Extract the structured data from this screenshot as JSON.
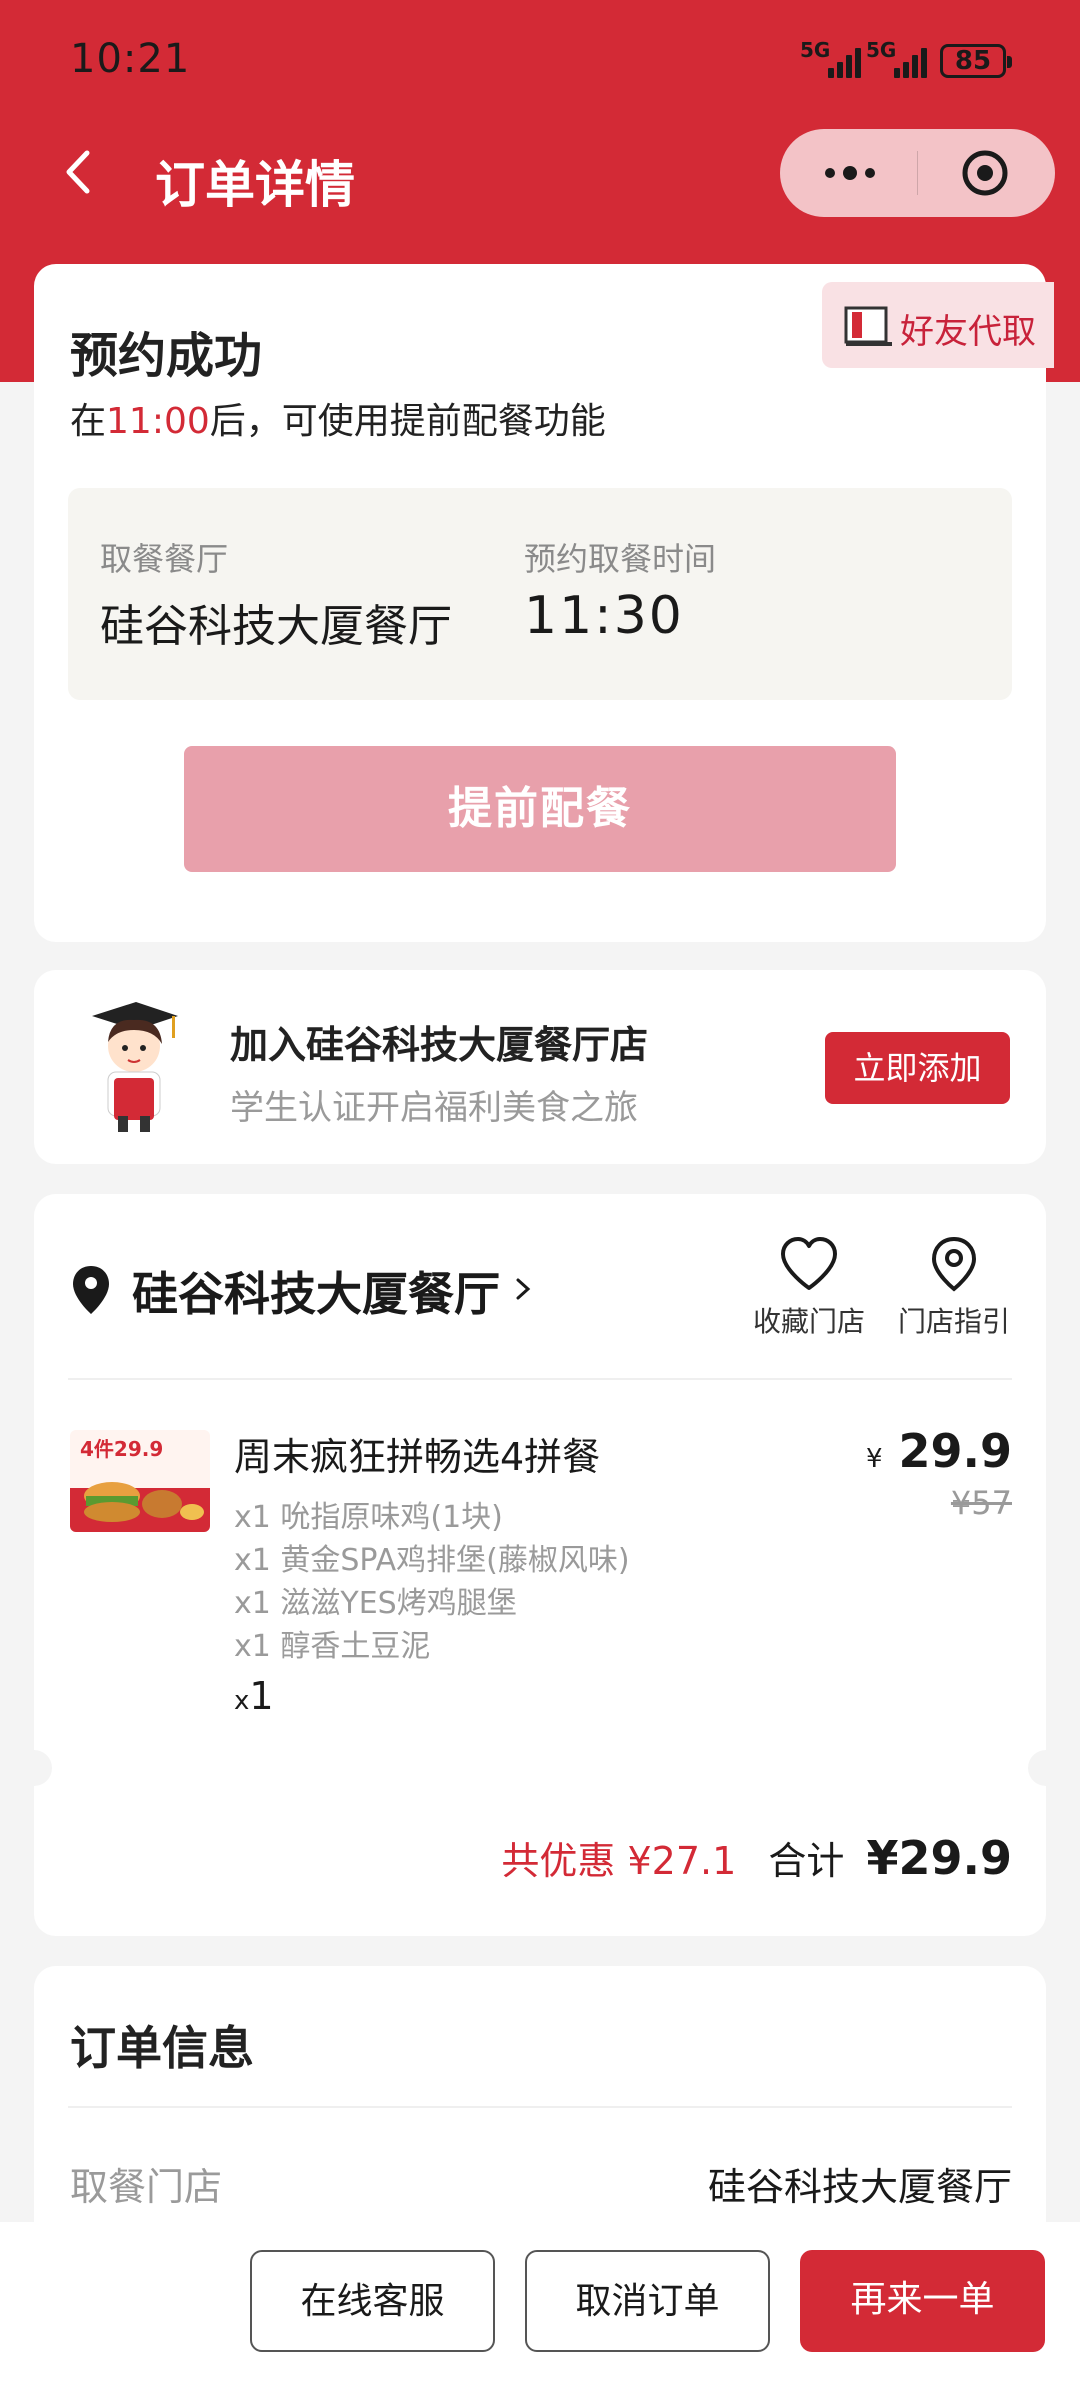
{
  "status_bar": {
    "time": "10:21",
    "signal1": "5G",
    "signal2": "5G",
    "battery": "85"
  },
  "nav": {
    "title": "订单详情"
  },
  "reservation": {
    "friend_pickup": "好友代取",
    "heading": "预约成功",
    "subtitle_pre": "在",
    "subtitle_time": "11:00",
    "subtitle_post": "后，可使用提前配餐功能",
    "restaurant_label": "取餐餐厅",
    "restaurant_value": "硅谷科技大厦餐厅",
    "time_label": "预约取餐时间",
    "time_value": "11:30",
    "prep_button": "提前配餐"
  },
  "promo": {
    "title": "加入硅谷科技大厦餐厅店",
    "subtitle": "学生认证开启福利美食之旅",
    "button": "立即添加"
  },
  "store": {
    "name": "硅谷科技大厦餐厅",
    "favorite": "收藏门店",
    "directions": "门店指引"
  },
  "product": {
    "image_badge": "4件29.9",
    "name": "周末疯狂拼畅选4拼餐",
    "items": [
      "x1 吮指原味鸡(1块)",
      "x1 黄金SPA鸡排堡(藤椒风味)",
      "x1 滋滋YES烤鸡腿堡",
      "x1 醇香土豆泥"
    ],
    "qty_prefix": "x",
    "qty": "1",
    "currency": "¥",
    "price": "29.9",
    "old_price": "¥57"
  },
  "totals": {
    "discount_label": "共优惠",
    "discount_value": "¥27.1",
    "total_label": "合计",
    "total_value": "¥29.9"
  },
  "order_info": {
    "heading": "订单信息",
    "pickup_store_label": "取餐门店",
    "pickup_store_value": "硅谷科技大厦餐厅"
  },
  "bottom_bar": {
    "service": "在线客服",
    "cancel": "取消订单",
    "reorder": "再来一单"
  },
  "colors": {
    "brand_red": "#d32a36",
    "disabled_pink": "#e8a0ab"
  }
}
